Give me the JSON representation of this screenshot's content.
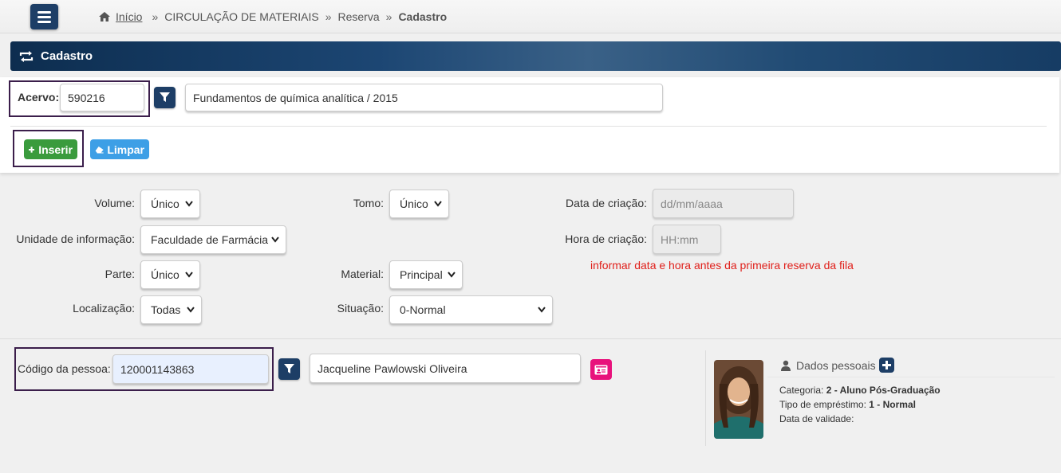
{
  "breadcrumb": {
    "home": "Início",
    "level1": "CIRCULAÇÃO DE MATERIAIS",
    "level2": "Reserva",
    "current": "Cadastro",
    "separator": "»"
  },
  "header": {
    "title": "Cadastro"
  },
  "acervo": {
    "label": "Acervo:",
    "value": "590216",
    "title_value": "Fundamentos de química analítica / 2015"
  },
  "actions": {
    "insert_label": "Inserir",
    "clear_label": "Limpar"
  },
  "form": {
    "volume_label": "Volume:",
    "volume_value": "Único",
    "tomo_label": "Tomo:",
    "tomo_value": "Único",
    "data_criacao_label": "Data de criação:",
    "data_criacao_placeholder": "dd/mm/aaaa",
    "unidade_label": "Unidade de informação:",
    "unidade_value": "Faculdade de Farmácia",
    "hora_criacao_label": "Hora de criação:",
    "hora_criacao_placeholder": "HH:mm",
    "note": "informar data e hora antes da primeira reserva da fila",
    "parte_label": "Parte:",
    "parte_value": "Único",
    "material_label": "Material:",
    "material_value": "Principal",
    "localizacao_label": "Localização:",
    "localizacao_value": "Todas",
    "situacao_label": "Situação:",
    "situacao_value": "0-Normal"
  },
  "person": {
    "code_label": "Código da pessoa:",
    "code_value": "120001143863",
    "name_value": "Jacqueline Pawlowski Oliveira"
  },
  "dados_pessoais": {
    "title": "Dados pessoais",
    "categoria_label": "Categoria:",
    "categoria_value": "2 - Aluno Pós-Graduação",
    "tipo_label": "Tipo de empréstimo:",
    "tipo_value": "1 - Normal",
    "validade_label": "Data de validade:"
  },
  "colors": {
    "navy": "#1d3e66",
    "green": "#3a9b3d",
    "blue": "#3d9fe6",
    "pink": "#e8127c",
    "note_red": "#e0201b",
    "highlight_border": "#3b1e4b"
  }
}
